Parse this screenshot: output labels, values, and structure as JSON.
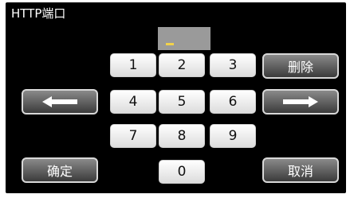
{
  "title": "HTTP端口",
  "field": {
    "value": ""
  },
  "keys": [
    "1",
    "2",
    "3",
    "4",
    "5",
    "6",
    "7",
    "8",
    "9",
    "0"
  ],
  "actions": {
    "delete": "删除",
    "confirm": "确定",
    "cancel": "取消"
  },
  "icons": {
    "left": "left-arrow-icon",
    "right": "right-arrow-icon"
  },
  "colors": {
    "screen": "#000000",
    "field": "#9a9a9a",
    "cursor": "#f2d24a",
    "key": "#ffffff",
    "action": "#5a5a5a"
  }
}
